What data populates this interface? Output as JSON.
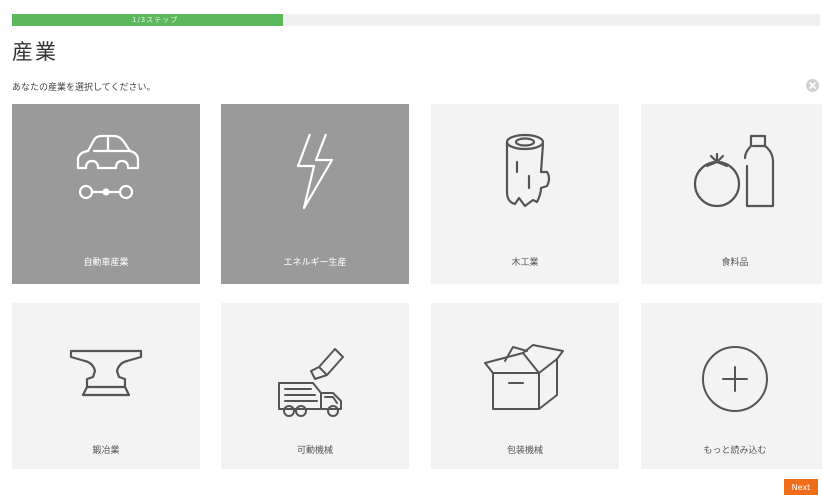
{
  "progress": {
    "fraction": 0.335,
    "label": "1/3ステップ"
  },
  "page": {
    "title": "産業",
    "subtitle": "あなたの産業を選択してください。"
  },
  "tiles": [
    {
      "label": "自動車産業",
      "icon": "car-chassis-icon",
      "selected": true
    },
    {
      "label": "エネルギー生産",
      "icon": "lightning-icon",
      "selected": true
    },
    {
      "label": "木工業",
      "icon": "log-icon",
      "selected": false
    },
    {
      "label": "食料品",
      "icon": "tomato-bottle-icon",
      "selected": false
    },
    {
      "label": "鍛冶業",
      "icon": "anvil-icon",
      "selected": false
    },
    {
      "label": "可動機械",
      "icon": "garbage-truck-icon",
      "selected": false
    },
    {
      "label": "包装機械",
      "icon": "box-icon",
      "selected": false
    },
    {
      "label": "もっと読み込む",
      "icon": "plus-circle-icon",
      "selected": false
    }
  ],
  "actions": {
    "next_label": "Next"
  },
  "colors": {
    "progress": "#5cb85c",
    "selected_tile": "#9a9a9a",
    "tile": "#f3f3f3",
    "next_button": "#ef6c1a"
  }
}
